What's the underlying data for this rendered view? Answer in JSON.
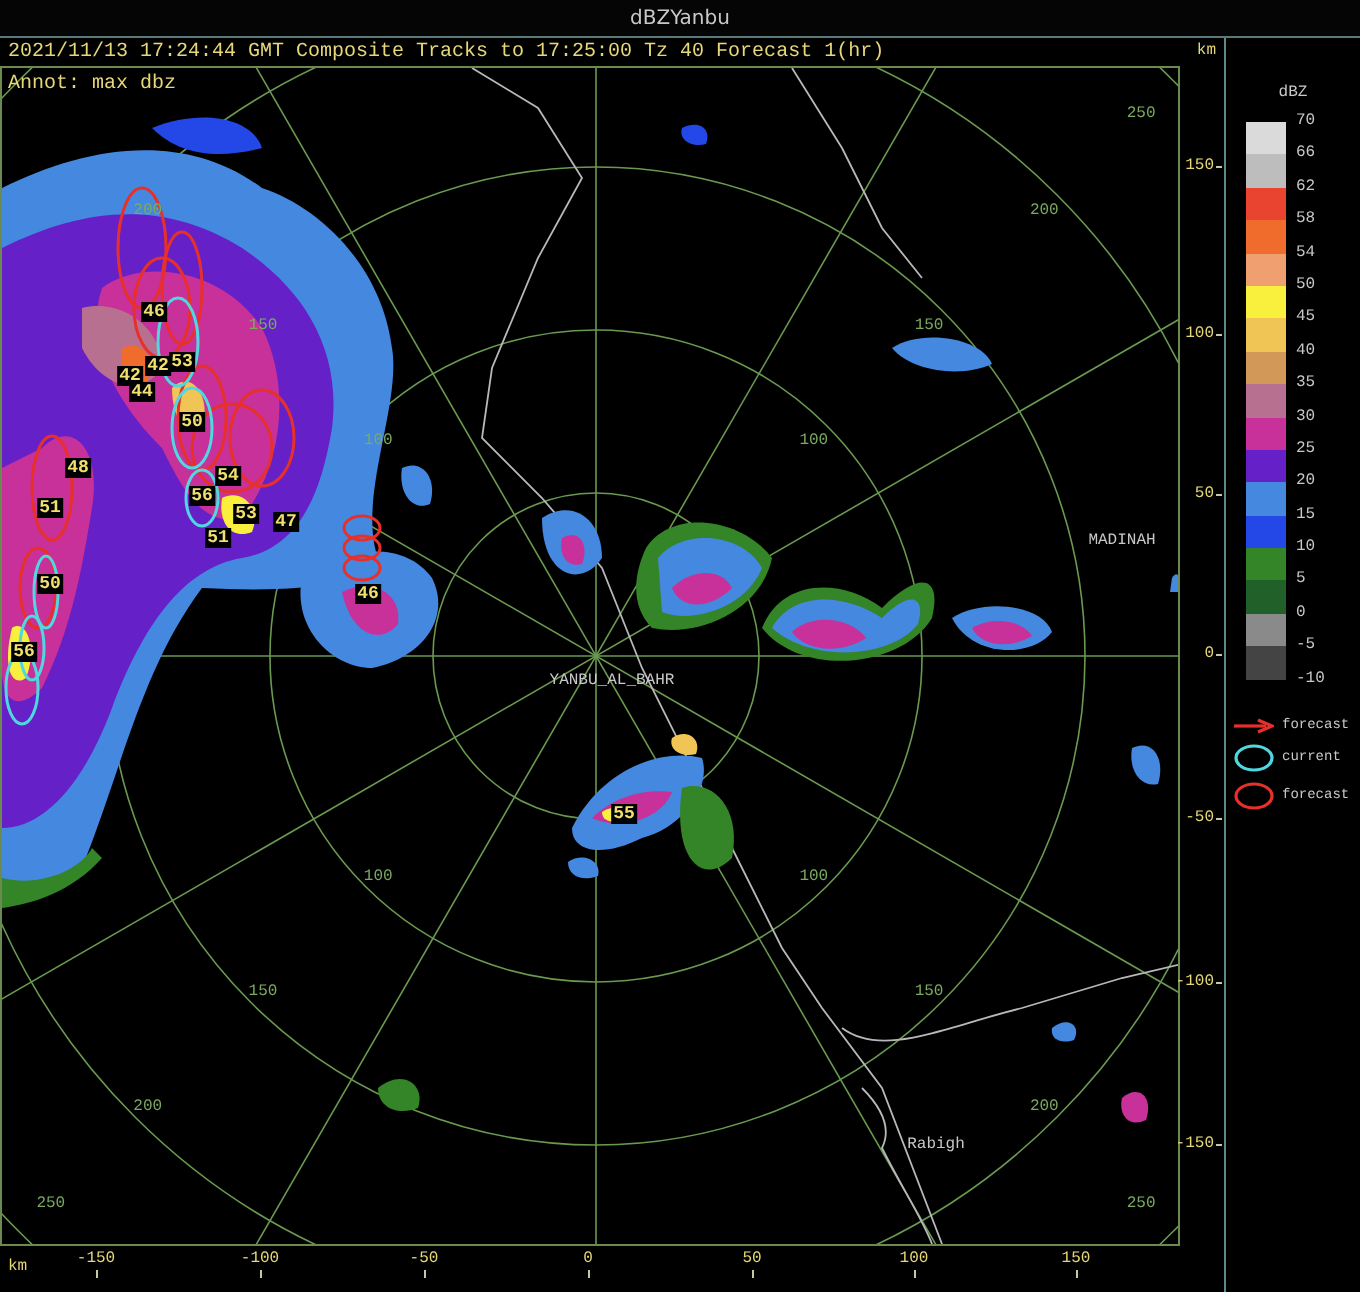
{
  "window": {
    "title": "dBZYanbu"
  },
  "header": {
    "text": "2021/11/13 17:24:44 GMT Composite Tracks to 17:25:00 Tz 40 Forecast 1(hr)",
    "annotation": "Annot: max dbz"
  },
  "map": {
    "range_ring_labels": [
      "100",
      "150",
      "200",
      "100",
      "150",
      "200",
      "250",
      "100",
      "150",
      "200",
      "250",
      "100",
      "150",
      "200",
      "250"
    ],
    "places": [
      "MADINAH",
      "YANBU_AL_BAHR",
      "Rabigh"
    ],
    "cell_labels": [
      "46",
      "42",
      "42",
      "44",
      "53",
      "50",
      "48",
      "54",
      "56",
      "53",
      "47",
      "51",
      "51",
      "50",
      "56",
      "46",
      "55"
    ]
  },
  "y_axis": {
    "unit": "km",
    "ticks": [
      "150",
      "100",
      "50",
      "0",
      "-50",
      "-100",
      "-150"
    ]
  },
  "x_axis": {
    "unit": "km",
    "ticks": [
      "-150",
      "-100",
      "-50",
      "0",
      "50",
      "100",
      "150"
    ]
  },
  "legend": {
    "title": "dBZ",
    "scale": [
      {
        "label": "70",
        "color": "#dadada"
      },
      {
        "label": "66",
        "color": "#bdbdbd"
      },
      {
        "label": "62",
        "color": "#e8442f"
      },
      {
        "label": "58",
        "color": "#ef6c2c"
      },
      {
        "label": "54",
        "color": "#f0a070"
      },
      {
        "label": "50",
        "color": "#f8f03c"
      },
      {
        "label": "45",
        "color": "#f0c455"
      },
      {
        "label": "40",
        "color": "#d29858"
      },
      {
        "label": "35",
        "color": "#b87090"
      },
      {
        "label": "30",
        "color": "#c8309a"
      },
      {
        "label": "25",
        "color": "#6620c8"
      },
      {
        "label": "20",
        "color": "#4488e0"
      },
      {
        "label": "15",
        "color": "#2448e8"
      },
      {
        "label": "10",
        "color": "#348428"
      },
      {
        "label": "5",
        "color": "#22602a"
      },
      {
        "label": "0",
        "color": "#8a8a8a"
      },
      {
        "label": "-5",
        "color": "#444444"
      }
    ],
    "bottom_label": "-10",
    "key": [
      {
        "kind": "arrow",
        "label": "forecast",
        "color": "#e8302a"
      },
      {
        "kind": "ellipse",
        "label": "current",
        "color": "#50d8e0"
      },
      {
        "kind": "ellipse",
        "label": "forecast",
        "color": "#e8302a"
      }
    ]
  }
}
